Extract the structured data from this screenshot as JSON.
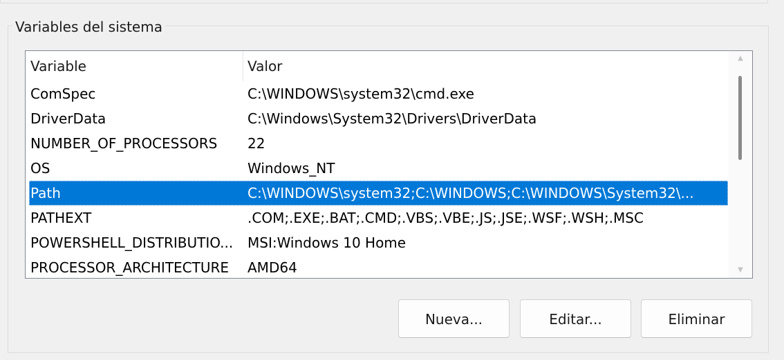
{
  "group": {
    "title": "Variables del sistema"
  },
  "list": {
    "columns": {
      "variable": "Variable",
      "valor": "Valor"
    },
    "rows": [
      {
        "variable": "ComSpec",
        "valor": "C:\\WINDOWS\\system32\\cmd.exe",
        "selected": false
      },
      {
        "variable": "DriverData",
        "valor": "C:\\Windows\\System32\\Drivers\\DriverData",
        "selected": false
      },
      {
        "variable": "NUMBER_OF_PROCESSORS",
        "valor": "22",
        "selected": false
      },
      {
        "variable": "OS",
        "valor": "Windows_NT",
        "selected": false
      },
      {
        "variable": "Path",
        "valor": "C:\\WINDOWS\\system32;C:\\WINDOWS;C:\\WINDOWS\\System32\\...",
        "selected": true
      },
      {
        "variable": "PATHEXT",
        "valor": ".COM;.EXE;.BAT;.CMD;.VBS;.VBE;.JS;.JSE;.WSF;.WSH;.MSC",
        "selected": false
      },
      {
        "variable": "POWERSHELL_DISTRIBUTIO...",
        "valor": "MSI:Windows 10 Home",
        "selected": false
      },
      {
        "variable": "PROCESSOR_ARCHITECTURE",
        "valor": "AMD64",
        "selected": false
      }
    ]
  },
  "scrollbar": {
    "up_icon": "chevron-up-icon",
    "down_icon": "chevron-down-icon"
  },
  "buttons": {
    "nueva": "Nueva...",
    "editar": "Editar...",
    "eliminar": "Eliminar"
  },
  "colors": {
    "selection": "#0078d7",
    "window_bg": "#f0f0f0"
  }
}
